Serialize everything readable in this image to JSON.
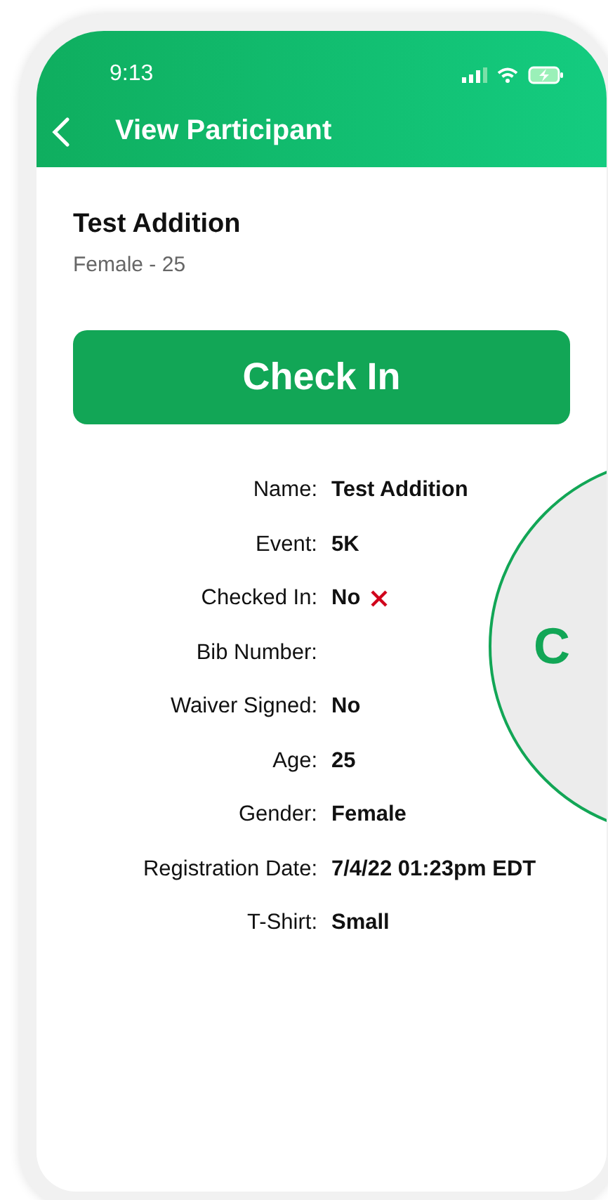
{
  "status_bar": {
    "time": "9:13"
  },
  "header": {
    "title": "View Participant"
  },
  "participant": {
    "name": "Test Addition",
    "subtitle": "Female - 25"
  },
  "check_in_button": {
    "label": "Check In"
  },
  "details": [
    {
      "label": "Name:",
      "value": "Test Addition"
    },
    {
      "label": "Event:",
      "value": "5K"
    },
    {
      "label": "Checked In:",
      "value": "No",
      "kind": "status",
      "checked": false
    },
    {
      "label": "Bib Number:"
    },
    {
      "label": "Waiver Signed:",
      "value": "No"
    },
    {
      "label": "Age:",
      "value": "25"
    },
    {
      "label": "Gender:",
      "value": "Female"
    },
    {
      "label": "Registration Date:",
      "value": "7/4/22 01:23pm EDT"
    },
    {
      "label": "T-Shirt:",
      "value": "Small"
    }
  ],
  "magnifier": {
    "text": "C"
  }
}
